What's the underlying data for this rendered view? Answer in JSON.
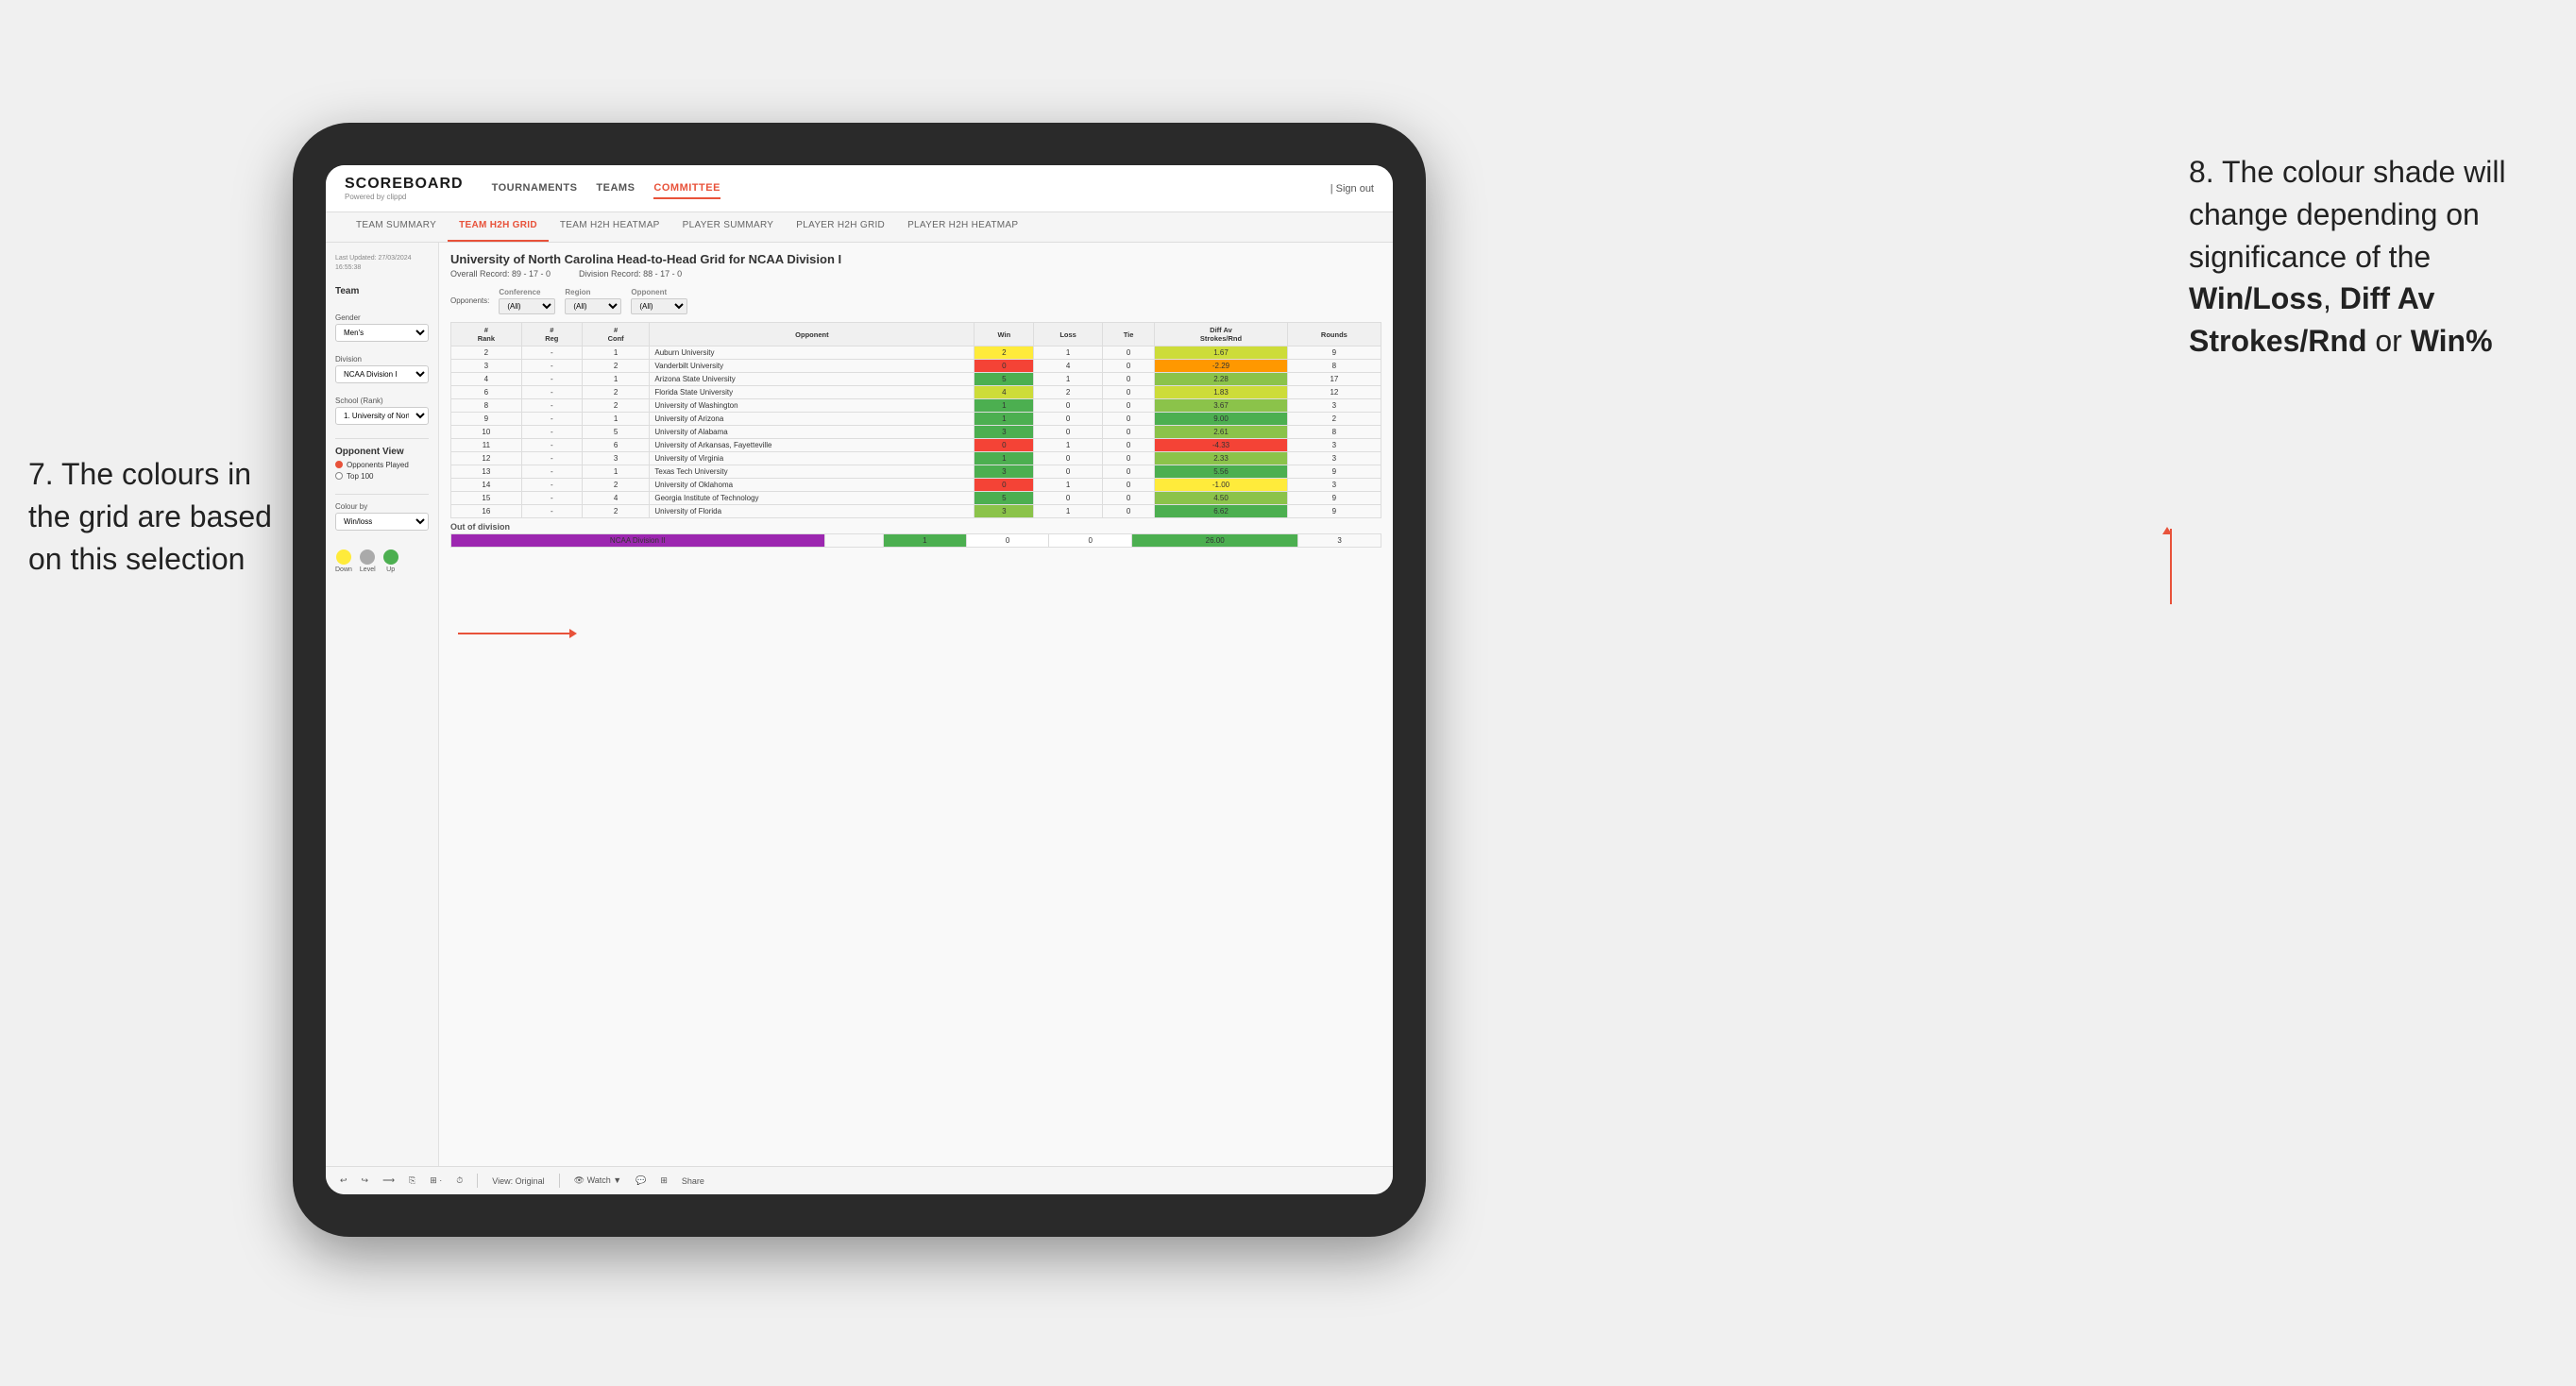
{
  "annotation_left": {
    "line1": "7. The colours in",
    "line2": "the grid are based",
    "line3": "on this selection"
  },
  "annotation_right": {
    "intro": "8. The colour shade will change depending on significance of the ",
    "bold1": "Win/Loss",
    "sep1": ", ",
    "bold2": "Diff Av Strokes/Rnd",
    "sep2": " or ",
    "bold3": "Win%"
  },
  "header": {
    "logo": "SCOREBOARD",
    "logo_sub": "Powered by clippd",
    "nav": [
      "TOURNAMENTS",
      "TEAMS",
      "COMMITTEE"
    ],
    "active_nav": "COMMITTEE",
    "sign_out": "Sign out"
  },
  "sub_nav": {
    "items": [
      "TEAM SUMMARY",
      "TEAM H2H GRID",
      "TEAM H2H HEATMAP",
      "PLAYER SUMMARY",
      "PLAYER H2H GRID",
      "PLAYER H2H HEATMAP"
    ],
    "active": "TEAM H2H GRID"
  },
  "sidebar": {
    "last_updated_label": "Last Updated: 27/03/2024",
    "last_updated_time": "16:55:38",
    "team_label": "Team",
    "gender_label": "Gender",
    "gender_value": "Men's",
    "division_label": "Division",
    "division_value": "NCAA Division I",
    "school_label": "School (Rank)",
    "school_value": "1. University of Nort...",
    "opponent_view_label": "Opponent View",
    "opponent_view_options": [
      "Opponents Played",
      "Top 100"
    ],
    "opponent_view_selected": "Opponents Played",
    "colour_by_label": "Colour by",
    "colour_by_value": "Win/loss",
    "legend": {
      "down": "Down",
      "level": "Level",
      "up": "Up"
    }
  },
  "grid": {
    "title": "University of North Carolina Head-to-Head Grid for NCAA Division I",
    "overall_record": "Overall Record: 89 - 17 - 0",
    "division_record": "Division Record: 88 - 17 - 0",
    "filters": {
      "opponents_label": "Opponents:",
      "conference_label": "Conference",
      "conference_value": "(All)",
      "region_label": "Region",
      "region_value": "(All)",
      "opponent_label": "Opponent",
      "opponent_value": "(All)"
    },
    "columns": [
      "#\nRank",
      "#\nReg",
      "#\nConf",
      "Opponent",
      "Win",
      "Loss",
      "Tie",
      "Diff Av\nStrokes/Rnd",
      "Rounds"
    ],
    "rows": [
      {
        "rank": "2",
        "reg": "-",
        "conf": "1",
        "opponent": "Auburn University",
        "win": "2",
        "loss": "1",
        "tie": "0",
        "diff": "1.67",
        "rounds": "9",
        "win_color": "yellow",
        "diff_color": "green_light"
      },
      {
        "rank": "3",
        "reg": "-",
        "conf": "2",
        "opponent": "Vanderbilt University",
        "win": "0",
        "loss": "4",
        "tie": "0",
        "diff": "-2.29",
        "rounds": "8",
        "win_color": "red",
        "diff_color": "orange"
      },
      {
        "rank": "4",
        "reg": "-",
        "conf": "1",
        "opponent": "Arizona State University",
        "win": "5",
        "loss": "1",
        "tie": "0",
        "diff": "2.28",
        "rounds": "17",
        "win_color": "green_dark",
        "diff_color": "green_mid"
      },
      {
        "rank": "6",
        "reg": "-",
        "conf": "2",
        "opponent": "Florida State University",
        "win": "4",
        "loss": "2",
        "tie": "0",
        "diff": "1.83",
        "rounds": "12",
        "win_color": "green_light",
        "diff_color": "green_light"
      },
      {
        "rank": "8",
        "reg": "-",
        "conf": "2",
        "opponent": "University of Washington",
        "win": "1",
        "loss": "0",
        "tie": "0",
        "diff": "3.67",
        "rounds": "3",
        "win_color": "green_dark",
        "diff_color": "green_mid"
      },
      {
        "rank": "9",
        "reg": "-",
        "conf": "1",
        "opponent": "University of Arizona",
        "win": "1",
        "loss": "0",
        "tie": "0",
        "diff": "9.00",
        "rounds": "2",
        "win_color": "green_dark",
        "diff_color": "green_dark"
      },
      {
        "rank": "10",
        "reg": "-",
        "conf": "5",
        "opponent": "University of Alabama",
        "win": "3",
        "loss": "0",
        "tie": "0",
        "diff": "2.61",
        "rounds": "8",
        "win_color": "green_dark",
        "diff_color": "green_mid"
      },
      {
        "rank": "11",
        "reg": "-",
        "conf": "6",
        "opponent": "University of Arkansas, Fayetteville",
        "win": "0",
        "loss": "1",
        "tie": "0",
        "diff": "-4.33",
        "rounds": "3",
        "win_color": "red",
        "diff_color": "red"
      },
      {
        "rank": "12",
        "reg": "-",
        "conf": "3",
        "opponent": "University of Virginia",
        "win": "1",
        "loss": "0",
        "tie": "0",
        "diff": "2.33",
        "rounds": "3",
        "win_color": "green_dark",
        "diff_color": "green_mid"
      },
      {
        "rank": "13",
        "reg": "-",
        "conf": "1",
        "opponent": "Texas Tech University",
        "win": "3",
        "loss": "0",
        "tie": "0",
        "diff": "5.56",
        "rounds": "9",
        "win_color": "green_dark",
        "diff_color": "green_dark"
      },
      {
        "rank": "14",
        "reg": "-",
        "conf": "2",
        "opponent": "University of Oklahoma",
        "win": "0",
        "loss": "1",
        "tie": "0",
        "diff": "-1.00",
        "rounds": "3",
        "win_color": "red",
        "diff_color": "yellow"
      },
      {
        "rank": "15",
        "reg": "-",
        "conf": "4",
        "opponent": "Georgia Institute of Technology",
        "win": "5",
        "loss": "0",
        "tie": "0",
        "diff": "4.50",
        "rounds": "9",
        "win_color": "green_dark",
        "diff_color": "green_mid"
      },
      {
        "rank": "16",
        "reg": "-",
        "conf": "2",
        "opponent": "University of Florida",
        "win": "3",
        "loss": "1",
        "tie": "0",
        "diff": "6.62",
        "rounds": "9",
        "win_color": "green_mid",
        "diff_color": "green_dark"
      }
    ],
    "out_of_division_label": "Out of division",
    "out_of_division_row": {
      "division": "NCAA Division II",
      "win": "1",
      "loss": "0",
      "tie": "0",
      "diff": "26.00",
      "rounds": "3",
      "win_color": "green_dark",
      "diff_color": "green_dark"
    }
  },
  "toolbar": {
    "view_original": "View: Original",
    "watch": "Watch ▼",
    "share": "Share"
  }
}
